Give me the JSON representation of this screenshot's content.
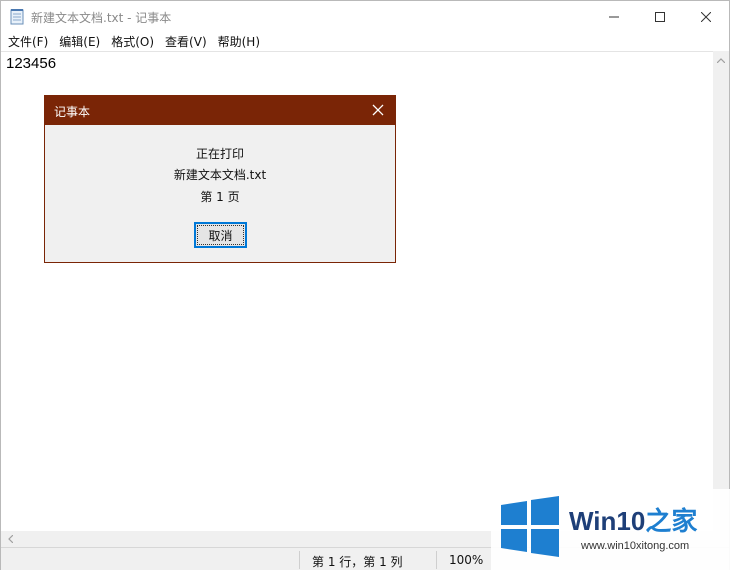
{
  "window": {
    "title": "新建文本文档.txt - 记事本"
  },
  "menu": {
    "items": [
      "文件(F)",
      "编辑(E)",
      "格式(O)",
      "查看(V)",
      "帮助(H)"
    ]
  },
  "editor": {
    "content": "123456"
  },
  "statusbar": {
    "position": "第 1 行，第 1 列",
    "zoom": "100%"
  },
  "dialog": {
    "title": "记事本",
    "line1": "正在打印",
    "line2": "新建文本文档.txt",
    "line3": "第 1 页",
    "cancel_label": "取消"
  },
  "watermark": {
    "brand_main": "Win10",
    "brand_accent": "之家",
    "url": "www.win10xitong.com"
  },
  "colors": {
    "dialog_accent": "#7a2506",
    "focus_blue": "#0078d7",
    "brand_blue": "#1e7fd0"
  },
  "icons": {
    "app": "notepad-icon",
    "minimize": "minimize-icon",
    "maximize": "maximize-icon",
    "close": "close-icon",
    "dialog_close": "close-icon",
    "scroll_up": "chevron-up-icon",
    "scroll_left": "chevron-left-icon",
    "watermark_logo": "windows-logo-icon"
  }
}
